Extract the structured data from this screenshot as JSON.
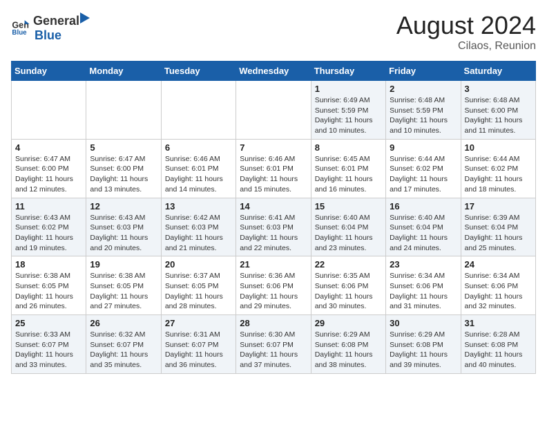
{
  "logo": {
    "general": "General",
    "blue": "Blue"
  },
  "title": {
    "month_year": "August 2024",
    "location": "Cilaos, Reunion"
  },
  "weekdays": [
    "Sunday",
    "Monday",
    "Tuesday",
    "Wednesday",
    "Thursday",
    "Friday",
    "Saturday"
  ],
  "weeks": [
    [
      {
        "day": "",
        "info": ""
      },
      {
        "day": "",
        "info": ""
      },
      {
        "day": "",
        "info": ""
      },
      {
        "day": "",
        "info": ""
      },
      {
        "day": "1",
        "info": "Sunrise: 6:49 AM\nSunset: 5:59 PM\nDaylight: 11 hours and 10 minutes."
      },
      {
        "day": "2",
        "info": "Sunrise: 6:48 AM\nSunset: 5:59 PM\nDaylight: 11 hours and 10 minutes."
      },
      {
        "day": "3",
        "info": "Sunrise: 6:48 AM\nSunset: 6:00 PM\nDaylight: 11 hours and 11 minutes."
      }
    ],
    [
      {
        "day": "4",
        "info": "Sunrise: 6:47 AM\nSunset: 6:00 PM\nDaylight: 11 hours and 12 minutes."
      },
      {
        "day": "5",
        "info": "Sunrise: 6:47 AM\nSunset: 6:00 PM\nDaylight: 11 hours and 13 minutes."
      },
      {
        "day": "6",
        "info": "Sunrise: 6:46 AM\nSunset: 6:01 PM\nDaylight: 11 hours and 14 minutes."
      },
      {
        "day": "7",
        "info": "Sunrise: 6:46 AM\nSunset: 6:01 PM\nDaylight: 11 hours and 15 minutes."
      },
      {
        "day": "8",
        "info": "Sunrise: 6:45 AM\nSunset: 6:01 PM\nDaylight: 11 hours and 16 minutes."
      },
      {
        "day": "9",
        "info": "Sunrise: 6:44 AM\nSunset: 6:02 PM\nDaylight: 11 hours and 17 minutes."
      },
      {
        "day": "10",
        "info": "Sunrise: 6:44 AM\nSunset: 6:02 PM\nDaylight: 11 hours and 18 minutes."
      }
    ],
    [
      {
        "day": "11",
        "info": "Sunrise: 6:43 AM\nSunset: 6:02 PM\nDaylight: 11 hours and 19 minutes."
      },
      {
        "day": "12",
        "info": "Sunrise: 6:43 AM\nSunset: 6:03 PM\nDaylight: 11 hours and 20 minutes."
      },
      {
        "day": "13",
        "info": "Sunrise: 6:42 AM\nSunset: 6:03 PM\nDaylight: 11 hours and 21 minutes."
      },
      {
        "day": "14",
        "info": "Sunrise: 6:41 AM\nSunset: 6:03 PM\nDaylight: 11 hours and 22 minutes."
      },
      {
        "day": "15",
        "info": "Sunrise: 6:40 AM\nSunset: 6:04 PM\nDaylight: 11 hours and 23 minutes."
      },
      {
        "day": "16",
        "info": "Sunrise: 6:40 AM\nSunset: 6:04 PM\nDaylight: 11 hours and 24 minutes."
      },
      {
        "day": "17",
        "info": "Sunrise: 6:39 AM\nSunset: 6:04 PM\nDaylight: 11 hours and 25 minutes."
      }
    ],
    [
      {
        "day": "18",
        "info": "Sunrise: 6:38 AM\nSunset: 6:05 PM\nDaylight: 11 hours and 26 minutes."
      },
      {
        "day": "19",
        "info": "Sunrise: 6:38 AM\nSunset: 6:05 PM\nDaylight: 11 hours and 27 minutes."
      },
      {
        "day": "20",
        "info": "Sunrise: 6:37 AM\nSunset: 6:05 PM\nDaylight: 11 hours and 28 minutes."
      },
      {
        "day": "21",
        "info": "Sunrise: 6:36 AM\nSunset: 6:06 PM\nDaylight: 11 hours and 29 minutes."
      },
      {
        "day": "22",
        "info": "Sunrise: 6:35 AM\nSunset: 6:06 PM\nDaylight: 11 hours and 30 minutes."
      },
      {
        "day": "23",
        "info": "Sunrise: 6:34 AM\nSunset: 6:06 PM\nDaylight: 11 hours and 31 minutes."
      },
      {
        "day": "24",
        "info": "Sunrise: 6:34 AM\nSunset: 6:06 PM\nDaylight: 11 hours and 32 minutes."
      }
    ],
    [
      {
        "day": "25",
        "info": "Sunrise: 6:33 AM\nSunset: 6:07 PM\nDaylight: 11 hours and 33 minutes."
      },
      {
        "day": "26",
        "info": "Sunrise: 6:32 AM\nSunset: 6:07 PM\nDaylight: 11 hours and 35 minutes."
      },
      {
        "day": "27",
        "info": "Sunrise: 6:31 AM\nSunset: 6:07 PM\nDaylight: 11 hours and 36 minutes."
      },
      {
        "day": "28",
        "info": "Sunrise: 6:30 AM\nSunset: 6:07 PM\nDaylight: 11 hours and 37 minutes."
      },
      {
        "day": "29",
        "info": "Sunrise: 6:29 AM\nSunset: 6:08 PM\nDaylight: 11 hours and 38 minutes."
      },
      {
        "day": "30",
        "info": "Sunrise: 6:29 AM\nSunset: 6:08 PM\nDaylight: 11 hours and 39 minutes."
      },
      {
        "day": "31",
        "info": "Sunrise: 6:28 AM\nSunset: 6:08 PM\nDaylight: 11 hours and 40 minutes."
      }
    ]
  ]
}
